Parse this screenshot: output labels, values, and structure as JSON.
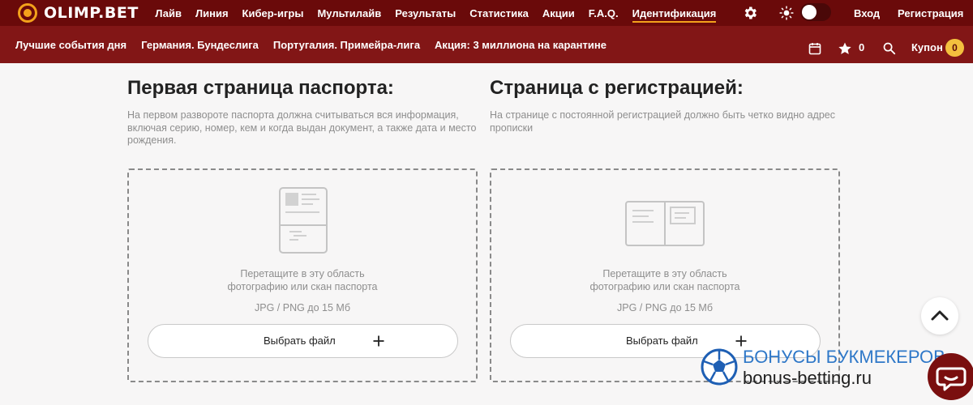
{
  "brand": {
    "name": "OLIMP.BET",
    "accent": "#f3a21b",
    "topbar_bg": "#6a0a0a",
    "subbar_bg": "#821616"
  },
  "nav": {
    "items": [
      {
        "label": "Лайв"
      },
      {
        "label": "Линия"
      },
      {
        "label": "Кибер-игры"
      },
      {
        "label": "Мультилайв"
      },
      {
        "label": "Результаты"
      },
      {
        "label": "Статистика"
      },
      {
        "label": "Акции"
      },
      {
        "label": "F.A.Q."
      },
      {
        "label": "Идентификация",
        "active": true
      }
    ],
    "login": "Вход",
    "register": "Регистрация",
    "settings_icon": "gear-icon",
    "theme_icon": "sun-icon"
  },
  "subnav": {
    "items": [
      {
        "label": "Лучшие события дня"
      },
      {
        "label": "Германия. Бундеслига"
      },
      {
        "label": "Португалия. Примейра-лига"
      },
      {
        "label": "Акция: 3 миллиона на карантине"
      }
    ],
    "favorites_count": "0",
    "coupon_label": "Купон",
    "coupon_count": "0"
  },
  "passport": {
    "title": "Первая страница паспорта:",
    "description": "На первом развороте паспорта должна считываться вся информация, включая серию, номер, кем и когда выдан документ, а также дата и место рождения.",
    "hint_line1": "Перетащите в эту область",
    "hint_line2": "фотографию или скан паспорта",
    "formats": "JPG / PNG до 15 Мб",
    "button": "Выбрать файл"
  },
  "registration": {
    "title": "Страница с регистрацией:",
    "description": "На странице с постоянной регистрацией должно быть четко видно адрес прописки",
    "hint_line1": "Перетащите в эту область",
    "hint_line2": "фотографию или скан паспорта",
    "formats": "JPG / PNG до 15 Мб",
    "button": "Выбрать файл"
  },
  "watermark": {
    "line1": "БОНУСЫ БУКМЕКЕРОВ",
    "line2": "bonus-betting.ru"
  }
}
